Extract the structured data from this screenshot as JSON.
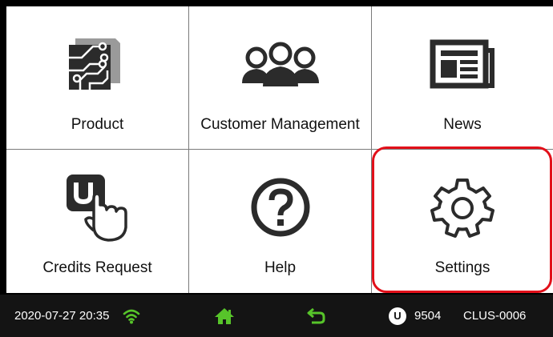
{
  "tiles": [
    {
      "label": "Product",
      "icon": "circuit-board-icon"
    },
    {
      "label": "Customer Management",
      "icon": "people-group-icon"
    },
    {
      "label": "News",
      "icon": "newspaper-icon"
    },
    {
      "label": "Credits Request",
      "icon": "credit-tap-icon"
    },
    {
      "label": "Help",
      "icon": "help-question-icon"
    },
    {
      "label": "Settings",
      "icon": "gear-icon"
    }
  ],
  "status": {
    "datetime": "2020-07-27 20:35",
    "credit_symbol": "U",
    "credits": "9504",
    "device_id": "CLUS-0006"
  },
  "colors": {
    "accent_green": "#57c42a",
    "highlight_red": "#e2101a",
    "icon_dark": "#2b2b2b",
    "statusbar_bg": "#141414"
  }
}
